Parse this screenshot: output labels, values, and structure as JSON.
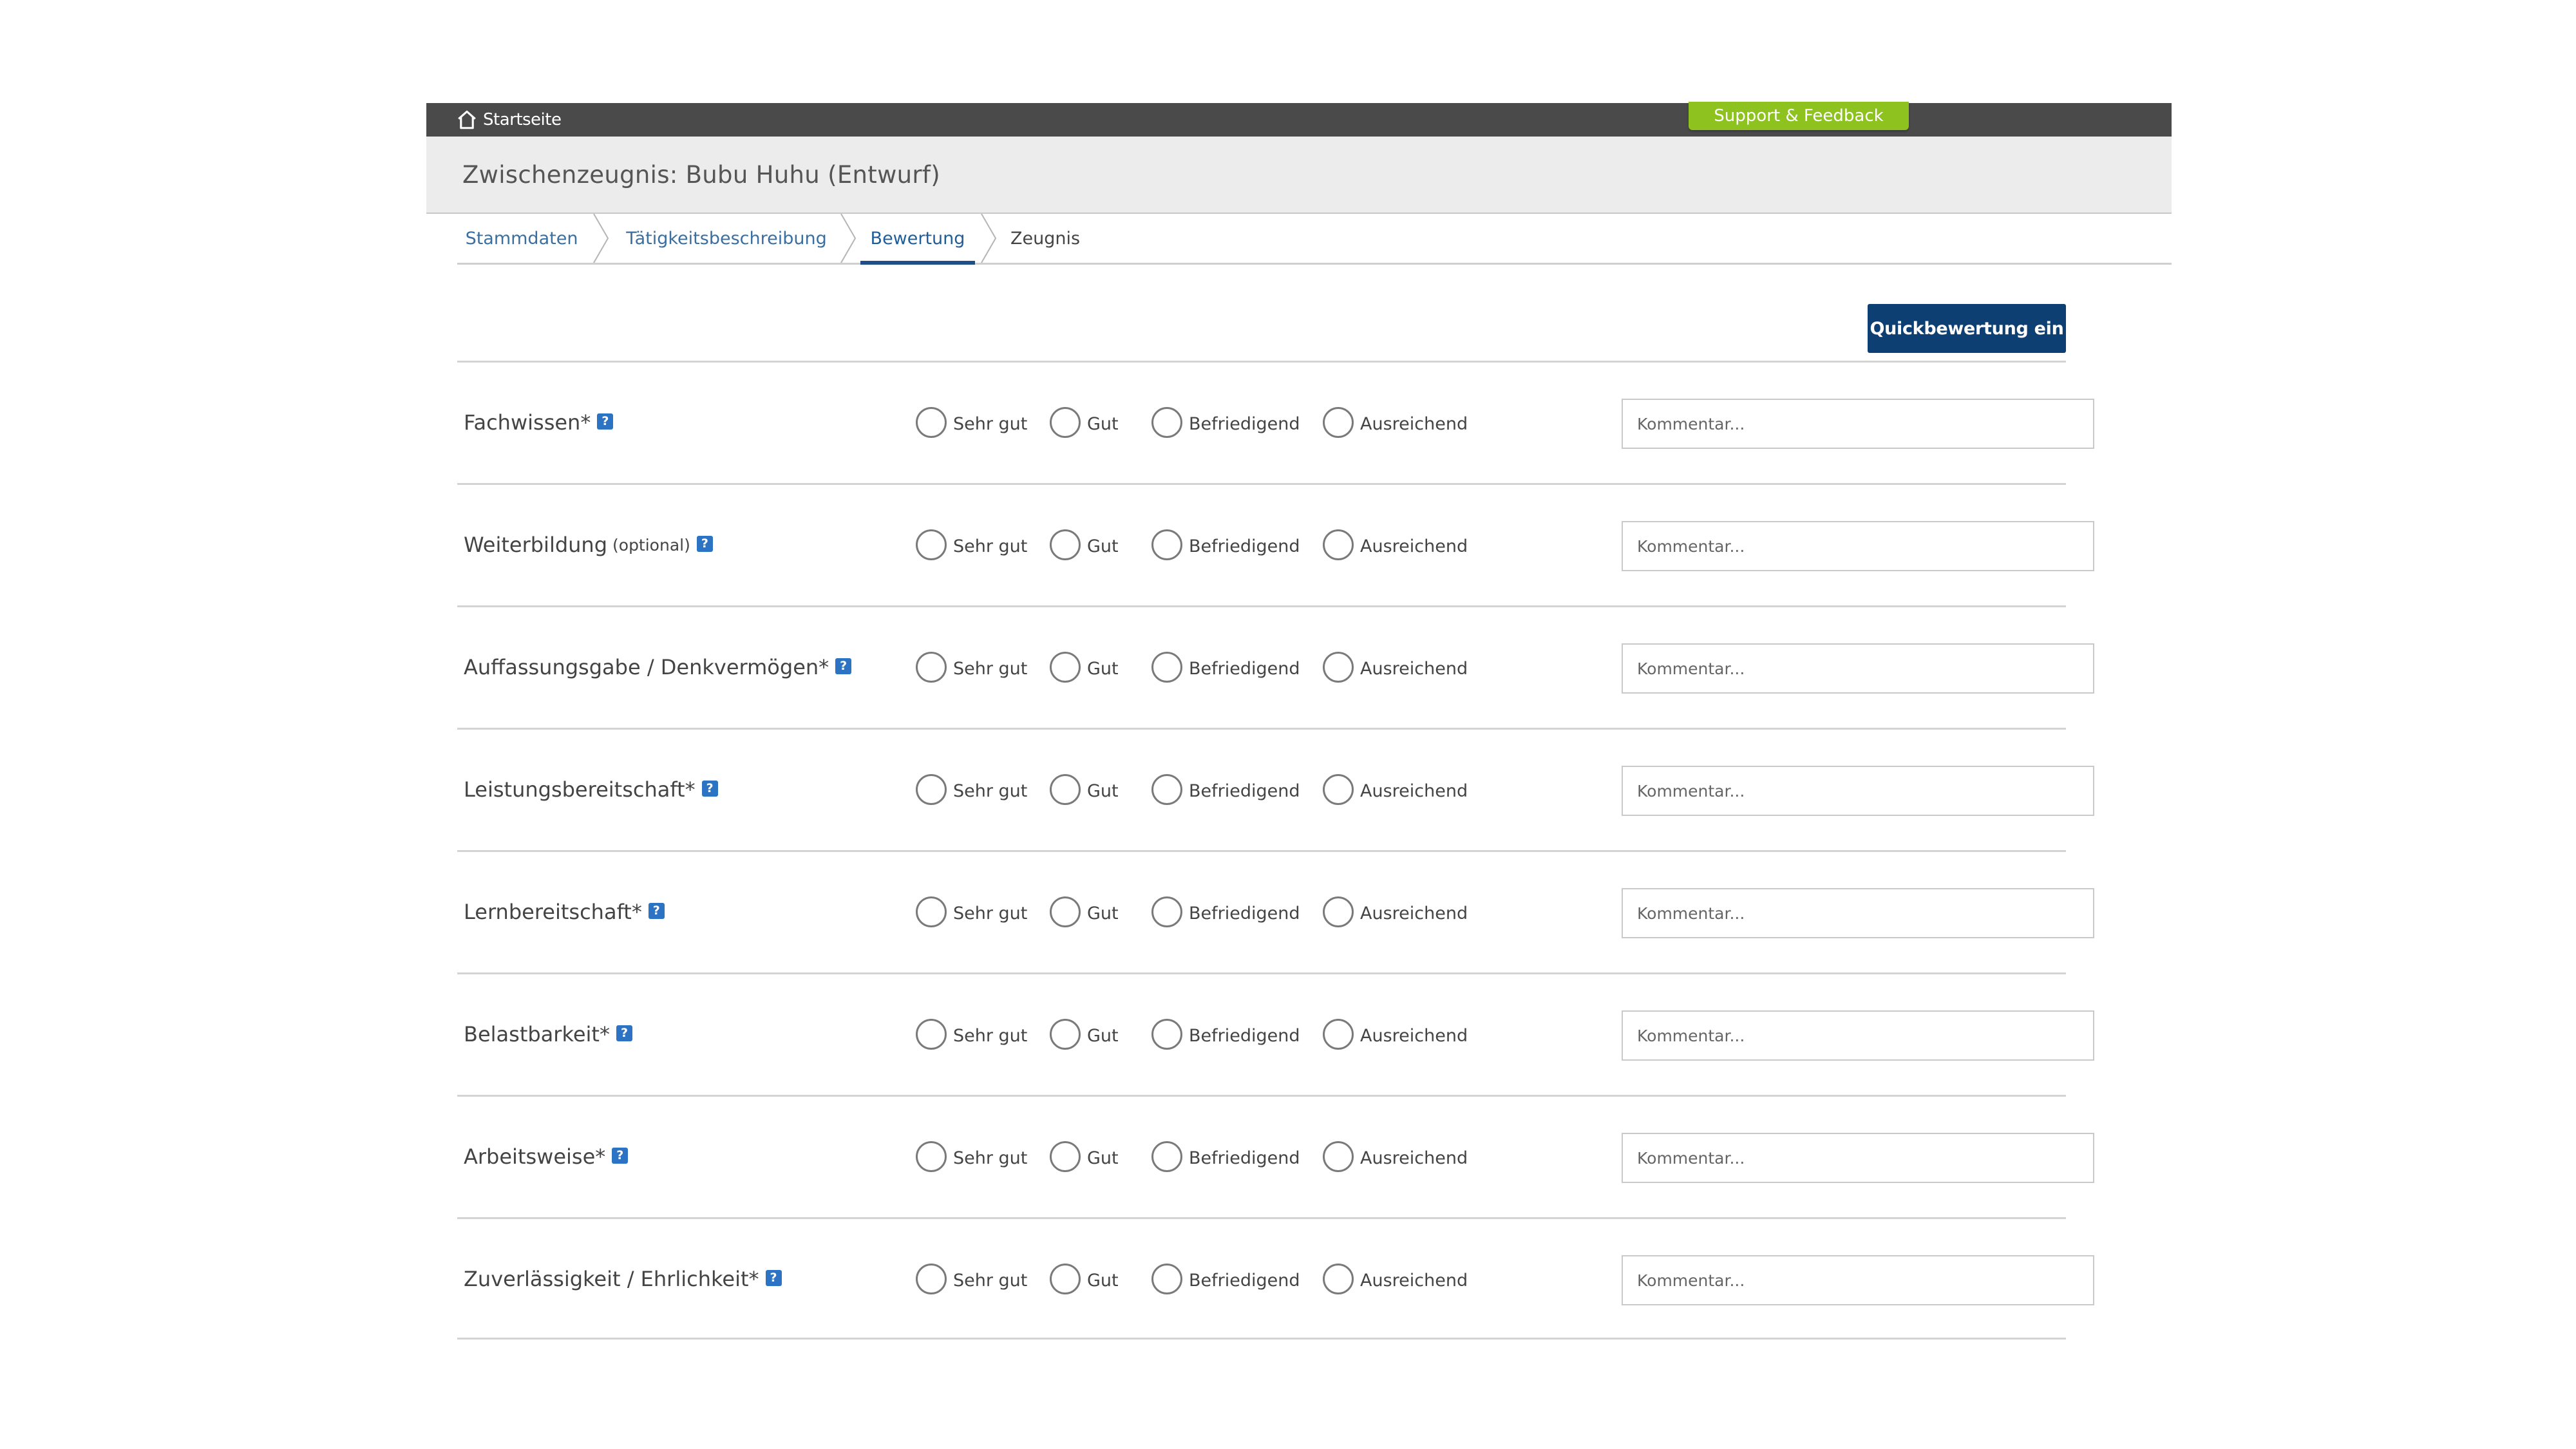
{
  "topbar": {
    "home_label": "Startseite",
    "support_label": "Support & Feedback",
    "support_color": "#8dc21f"
  },
  "page": {
    "title": "Zwischenzeugnis: Bubu Huhu (Entwurf)"
  },
  "tabs": [
    {
      "label": "Stammdaten",
      "state": "done"
    },
    {
      "label": "Tätigkeitsbeschreibung",
      "state": "done"
    },
    {
      "label": "Bewertung",
      "state": "active"
    },
    {
      "label": "Zeugnis",
      "state": "pending"
    }
  ],
  "quick_button": {
    "label": "Quickbewertung ein",
    "color": "#0e3f73"
  },
  "rating_options": [
    "Sehr gut",
    "Gut",
    "Befriedigend",
    "Ausreichend"
  ],
  "comment_placeholder": "Kommentar...",
  "help_icon_glyph": "?",
  "rows": [
    {
      "label": "Fachwissen*",
      "optional": ""
    },
    {
      "label": "Weiterbildung",
      "optional": "(optional)"
    },
    {
      "label": "Auffassungsgabe / Denkvermögen*",
      "optional": ""
    },
    {
      "label": "Leistungsbereitschaft*",
      "optional": ""
    },
    {
      "label": "Lernbereitschaft*",
      "optional": ""
    },
    {
      "label": "Belastbarkeit*",
      "optional": ""
    },
    {
      "label": "Arbeitsweise*",
      "optional": ""
    },
    {
      "label": "Zuverlässigkeit / Ehrlichkeit*",
      "optional": ""
    }
  ]
}
